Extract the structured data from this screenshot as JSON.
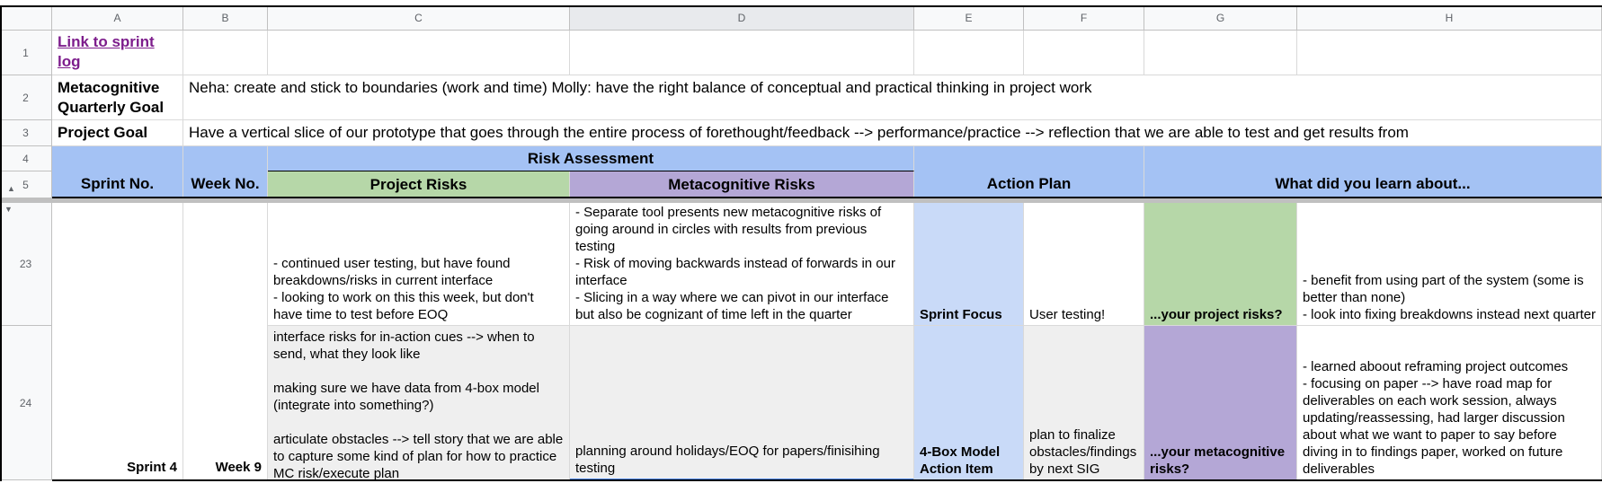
{
  "columns": [
    "A",
    "B",
    "C",
    "D",
    "E",
    "F",
    "G",
    "H"
  ],
  "rows": [
    "1",
    "2",
    "3",
    "4",
    "5",
    "23",
    "24"
  ],
  "row1": {
    "link": "Link to sprint\nlog"
  },
  "row2": {
    "label": "Metacognitive\nQuarterly Goal",
    "text": "Neha: create and stick to boundaries (work and time)\nMolly: have the right balance of conceptual and practical thinking in project work"
  },
  "row3": {
    "label": "Project Goal",
    "text": "Have a vertical slice of our prototype that goes through the entire process of forethought/feedback --> performance/practice --> reflection that we are able to test and get results from"
  },
  "header": {
    "sprint_no": "Sprint No.",
    "week_no": "Week No.",
    "risk_assessment": "Risk Assessment",
    "project_risks": "Project Risks",
    "metacognitive_risks": "Metacognitive Risks",
    "action_plan": "Action Plan",
    "learned": "What did you learn about..."
  },
  "row23": {
    "project_risks": "- continued user testing, but have found breakdowns/risks in current interface\n- looking to work on this this week, but don't have time to test before EOQ",
    "metacognitive_risks": "- Separate tool presents new metacognitive risks of going around in circles with results from previous testing\n- Risk of moving backwards instead of forwards in our interface\n- Slicing in a way where we can pivot in our interface but also be cognizant of time left in the quarter",
    "action_label": "Sprint Focus",
    "action_value": "User testing!",
    "learn_label": "...your project risks?",
    "learn_value": "- benefit from using part of the system (some is better than none)\n- look into fixing breakdowns instead next quarter"
  },
  "row24": {
    "sprint": "Sprint 4",
    "week": "Week 9",
    "project_risks": "interface risks for in-action cues --> when to send, what they look like\n\nmaking sure we have data from 4-box model (integrate into something?)\n\narticulate obstacles --> tell story that we are able to capture some kind of plan for how to practice MC risk/execute plan",
    "metacognitive_risks": "planning around holidays/EOQ for papers/finisihing testing",
    "action_label": "4-Box Model Action Item",
    "action_value": "plan to finalize obstacles/findings by next SIG",
    "learn_label": "...your metacognitive risks?",
    "learn_value": "- learned aboout reframing project outcomes\n- focusing on paper --> have road map for deliverables on each work session, always updating/reassessing, had larger discussion about what we want to paper to say before diving in to findings paper, worked on future deliverables"
  }
}
